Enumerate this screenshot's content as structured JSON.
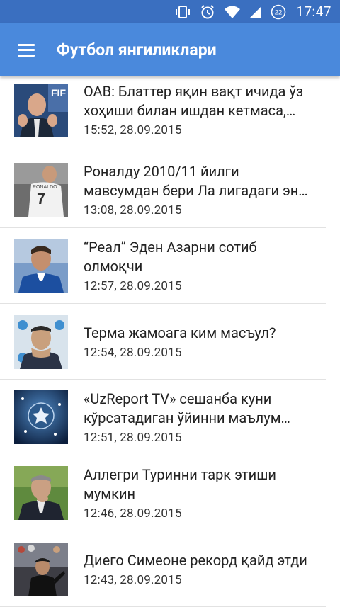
{
  "status_bar": {
    "time": "17:47",
    "notification_count": "22",
    "background": "#3a6fc0"
  },
  "app_bar": {
    "title": "Футбол янгиликлари",
    "menu_icon": "hamburger-menu-icon",
    "background": "#4a89dc"
  },
  "news": [
    {
      "title": "OAB: Блаттер яқин вақт ичида ўз\nхоҳиши билан ишдан кетмаса,…",
      "date": "15:52, 28.09.2015"
    },
    {
      "title": "Роналду 2010/11 йилги\nмавсумдан бери Ла лигадаги эн…",
      "date": "13:08, 28.09.2015"
    },
    {
      "title": "“Реал” Эден Азарни сотиб\nолмоқчи",
      "date": "12:57, 28.09.2015"
    },
    {
      "title": "Терма жамоага ким масъул?",
      "date": "12:54, 28.09.2015"
    },
    {
      "title": "«UzReport TV» сешанба куни\nкўрсатадиган ўйинни маълум…",
      "date": "12:51, 28.09.2015"
    },
    {
      "title": "Аллегри Туринни тарк этиши\nмумкин",
      "date": "12:46, 28.09.2015"
    },
    {
      "title": "Диего Симеоне рекорд қайд этди",
      "date": "12:43, 28.09.2015"
    }
  ]
}
